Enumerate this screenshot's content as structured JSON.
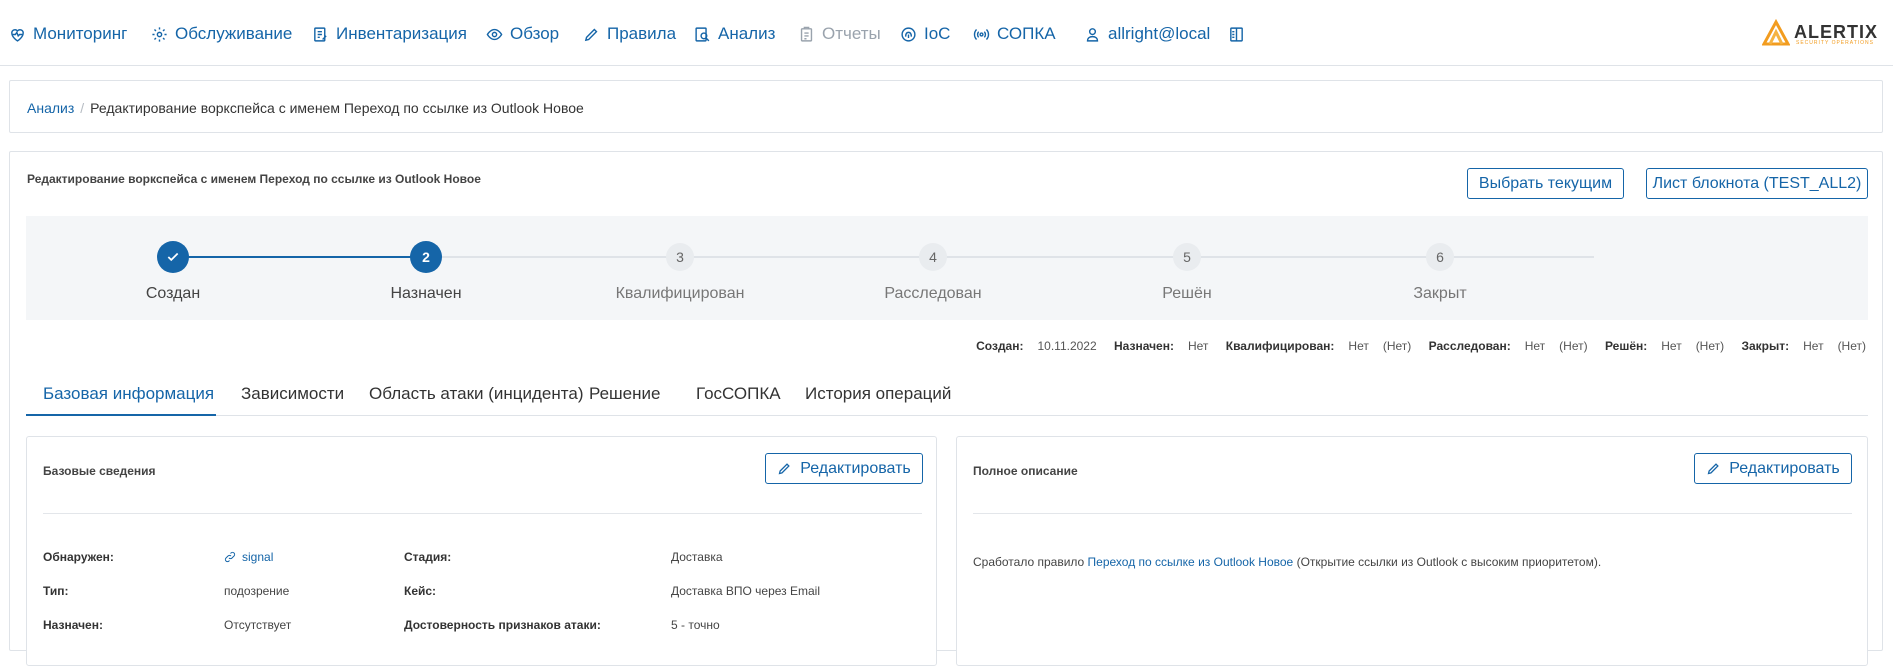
{
  "nav": {
    "items": [
      {
        "label": "Мониторинг",
        "icon": "heart-pulse-icon"
      },
      {
        "label": "Обслуживание",
        "icon": "gear-icon"
      },
      {
        "label": "Инвентаризация",
        "icon": "clipboard-edit-icon"
      },
      {
        "label": "Обзор",
        "icon": "eye-icon"
      },
      {
        "label": "Правила",
        "icon": "pencil-icon"
      },
      {
        "label": "Анализ",
        "icon": "search-document-icon"
      },
      {
        "label": "Отчеты",
        "icon": "report-icon",
        "disabled": true
      },
      {
        "label": "IoC",
        "icon": "fingerprint-icon"
      },
      {
        "label": "СОПКА",
        "icon": "broadcast-icon"
      },
      {
        "label": "allright@local",
        "icon": "user-icon"
      }
    ],
    "layout_toggle_icon": "layout-columns-icon"
  },
  "brand": {
    "name": "ALERTIX",
    "tagline": "SECURITY OPERATIONS"
  },
  "breadcrumb": {
    "parent": "Анализ",
    "separator": "/",
    "current": "Редактирование воркспейса с именем Переход по ссылке из Outlook Новое"
  },
  "workspace": {
    "title": "Редактирование воркспейса с именем Переход по ссылке из Outlook Новое",
    "select_current_label": "Выбрать текущим",
    "notebook_label": "Лист блокнота (TEST_ALL2)"
  },
  "stepper": {
    "steps": [
      {
        "number": "1",
        "label": "Создан",
        "state": "done"
      },
      {
        "number": "2",
        "label": "Назначен",
        "state": "active"
      },
      {
        "number": "3",
        "label": "Квалифицирован",
        "state": "todo"
      },
      {
        "number": "4",
        "label": "Расследован",
        "state": "todo"
      },
      {
        "number": "5",
        "label": "Решён",
        "state": "todo"
      },
      {
        "number": "6",
        "label": "Закрыт",
        "state": "todo"
      }
    ]
  },
  "status": {
    "created_label": "Создан:",
    "created_value": "10.11.2022",
    "assigned_label": "Назначен:",
    "assigned_value": "Нет",
    "qualified_label": "Квалифицирован:",
    "qualified_value": "Нет",
    "qualified_extra": "(Нет)",
    "investigated_label": "Расследован:",
    "investigated_value": "Нет",
    "investigated_extra": "(Нет)",
    "solved_label": "Решён:",
    "solved_value": "Нет",
    "solved_extra": "(Нет)",
    "closed_label": "Закрыт:",
    "closed_value": "Нет",
    "closed_extra": "(Нет)"
  },
  "tabs": [
    {
      "label": "Базовая информация",
      "active": true
    },
    {
      "label": "Зависимости"
    },
    {
      "label": "Область атаки (инцидента)"
    },
    {
      "label": "Решение"
    },
    {
      "label": "ГосСОПКА"
    },
    {
      "label": "История операций"
    }
  ],
  "basic_card": {
    "title": "Базовые сведения",
    "edit_label": "Редактировать",
    "fields": {
      "detected_label": "Обнаружен:",
      "detected_value": "signal",
      "type_label": "Тип:",
      "type_value": "подозрение",
      "assigned_label": "Назначен:",
      "assigned_value": "Отсутствует",
      "stage_label": "Стадия:",
      "stage_value": "Доставка",
      "case_label": "Кейс:",
      "case_value": "Доставка ВПО через Email",
      "confidence_label": "Достоверность признаков атаки:",
      "confidence_value": "5 - точно"
    }
  },
  "desc_card": {
    "title": "Полное описание",
    "edit_label": "Редактировать",
    "text_before": "Сработало правило ",
    "rule_link": "Переход по ссылке из Outlook Новое",
    "text_after": " (Открытие ссылки из Outlook с высоким приоритетом)."
  },
  "colors": {
    "accent": "#1565a8",
    "border": "#dfe3e8",
    "stepper_bg": "#f4f6f8",
    "brand_orange": "#f29c1f"
  }
}
